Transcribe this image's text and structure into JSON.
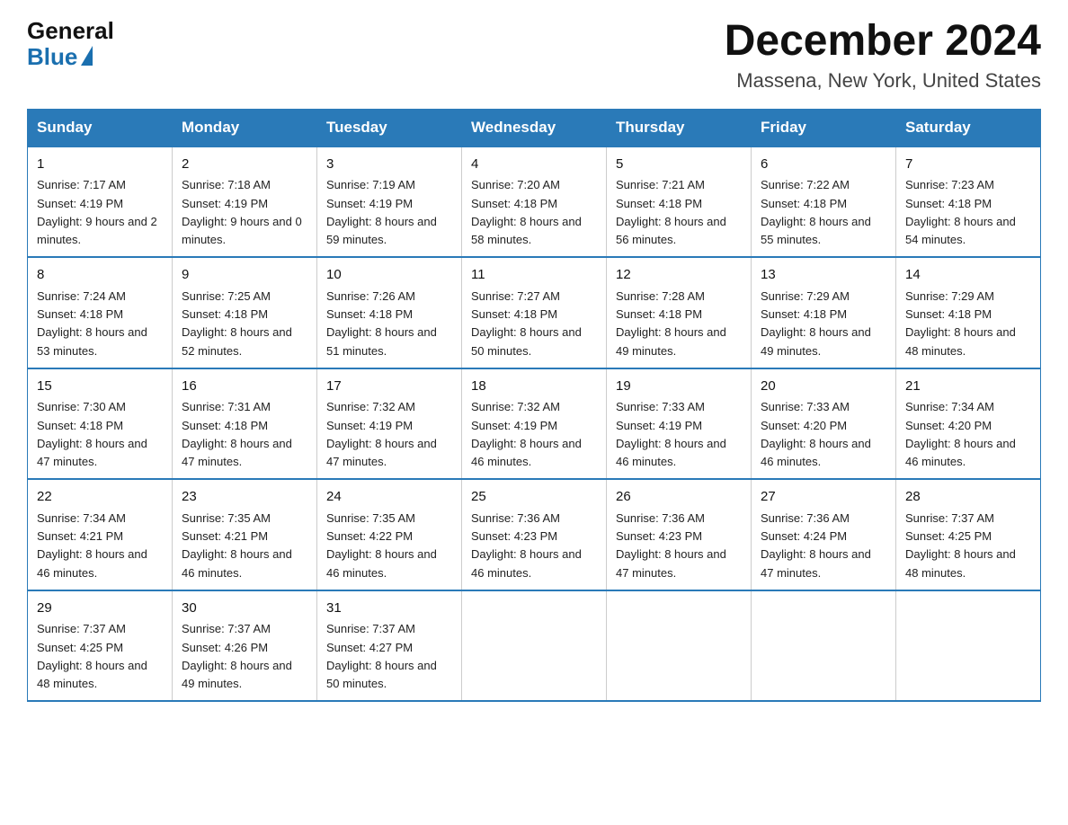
{
  "logo": {
    "general": "General",
    "blue": "Blue"
  },
  "title": "December 2024",
  "subtitle": "Massena, New York, United States",
  "days_of_week": [
    "Sunday",
    "Monday",
    "Tuesday",
    "Wednesday",
    "Thursday",
    "Friday",
    "Saturday"
  ],
  "weeks": [
    [
      {
        "day": "1",
        "sunrise": "Sunrise: 7:17 AM",
        "sunset": "Sunset: 4:19 PM",
        "daylight": "Daylight: 9 hours and 2 minutes."
      },
      {
        "day": "2",
        "sunrise": "Sunrise: 7:18 AM",
        "sunset": "Sunset: 4:19 PM",
        "daylight": "Daylight: 9 hours and 0 minutes."
      },
      {
        "day": "3",
        "sunrise": "Sunrise: 7:19 AM",
        "sunset": "Sunset: 4:19 PM",
        "daylight": "Daylight: 8 hours and 59 minutes."
      },
      {
        "day": "4",
        "sunrise": "Sunrise: 7:20 AM",
        "sunset": "Sunset: 4:18 PM",
        "daylight": "Daylight: 8 hours and 58 minutes."
      },
      {
        "day": "5",
        "sunrise": "Sunrise: 7:21 AM",
        "sunset": "Sunset: 4:18 PM",
        "daylight": "Daylight: 8 hours and 56 minutes."
      },
      {
        "day": "6",
        "sunrise": "Sunrise: 7:22 AM",
        "sunset": "Sunset: 4:18 PM",
        "daylight": "Daylight: 8 hours and 55 minutes."
      },
      {
        "day": "7",
        "sunrise": "Sunrise: 7:23 AM",
        "sunset": "Sunset: 4:18 PM",
        "daylight": "Daylight: 8 hours and 54 minutes."
      }
    ],
    [
      {
        "day": "8",
        "sunrise": "Sunrise: 7:24 AM",
        "sunset": "Sunset: 4:18 PM",
        "daylight": "Daylight: 8 hours and 53 minutes."
      },
      {
        "day": "9",
        "sunrise": "Sunrise: 7:25 AM",
        "sunset": "Sunset: 4:18 PM",
        "daylight": "Daylight: 8 hours and 52 minutes."
      },
      {
        "day": "10",
        "sunrise": "Sunrise: 7:26 AM",
        "sunset": "Sunset: 4:18 PM",
        "daylight": "Daylight: 8 hours and 51 minutes."
      },
      {
        "day": "11",
        "sunrise": "Sunrise: 7:27 AM",
        "sunset": "Sunset: 4:18 PM",
        "daylight": "Daylight: 8 hours and 50 minutes."
      },
      {
        "day": "12",
        "sunrise": "Sunrise: 7:28 AM",
        "sunset": "Sunset: 4:18 PM",
        "daylight": "Daylight: 8 hours and 49 minutes."
      },
      {
        "day": "13",
        "sunrise": "Sunrise: 7:29 AM",
        "sunset": "Sunset: 4:18 PM",
        "daylight": "Daylight: 8 hours and 49 minutes."
      },
      {
        "day": "14",
        "sunrise": "Sunrise: 7:29 AM",
        "sunset": "Sunset: 4:18 PM",
        "daylight": "Daylight: 8 hours and 48 minutes."
      }
    ],
    [
      {
        "day": "15",
        "sunrise": "Sunrise: 7:30 AM",
        "sunset": "Sunset: 4:18 PM",
        "daylight": "Daylight: 8 hours and 47 minutes."
      },
      {
        "day": "16",
        "sunrise": "Sunrise: 7:31 AM",
        "sunset": "Sunset: 4:18 PM",
        "daylight": "Daylight: 8 hours and 47 minutes."
      },
      {
        "day": "17",
        "sunrise": "Sunrise: 7:32 AM",
        "sunset": "Sunset: 4:19 PM",
        "daylight": "Daylight: 8 hours and 47 minutes."
      },
      {
        "day": "18",
        "sunrise": "Sunrise: 7:32 AM",
        "sunset": "Sunset: 4:19 PM",
        "daylight": "Daylight: 8 hours and 46 minutes."
      },
      {
        "day": "19",
        "sunrise": "Sunrise: 7:33 AM",
        "sunset": "Sunset: 4:19 PM",
        "daylight": "Daylight: 8 hours and 46 minutes."
      },
      {
        "day": "20",
        "sunrise": "Sunrise: 7:33 AM",
        "sunset": "Sunset: 4:20 PM",
        "daylight": "Daylight: 8 hours and 46 minutes."
      },
      {
        "day": "21",
        "sunrise": "Sunrise: 7:34 AM",
        "sunset": "Sunset: 4:20 PM",
        "daylight": "Daylight: 8 hours and 46 minutes."
      }
    ],
    [
      {
        "day": "22",
        "sunrise": "Sunrise: 7:34 AM",
        "sunset": "Sunset: 4:21 PM",
        "daylight": "Daylight: 8 hours and 46 minutes."
      },
      {
        "day": "23",
        "sunrise": "Sunrise: 7:35 AM",
        "sunset": "Sunset: 4:21 PM",
        "daylight": "Daylight: 8 hours and 46 minutes."
      },
      {
        "day": "24",
        "sunrise": "Sunrise: 7:35 AM",
        "sunset": "Sunset: 4:22 PM",
        "daylight": "Daylight: 8 hours and 46 minutes."
      },
      {
        "day": "25",
        "sunrise": "Sunrise: 7:36 AM",
        "sunset": "Sunset: 4:23 PM",
        "daylight": "Daylight: 8 hours and 46 minutes."
      },
      {
        "day": "26",
        "sunrise": "Sunrise: 7:36 AM",
        "sunset": "Sunset: 4:23 PM",
        "daylight": "Daylight: 8 hours and 47 minutes."
      },
      {
        "day": "27",
        "sunrise": "Sunrise: 7:36 AM",
        "sunset": "Sunset: 4:24 PM",
        "daylight": "Daylight: 8 hours and 47 minutes."
      },
      {
        "day": "28",
        "sunrise": "Sunrise: 7:37 AM",
        "sunset": "Sunset: 4:25 PM",
        "daylight": "Daylight: 8 hours and 48 minutes."
      }
    ],
    [
      {
        "day": "29",
        "sunrise": "Sunrise: 7:37 AM",
        "sunset": "Sunset: 4:25 PM",
        "daylight": "Daylight: 8 hours and 48 minutes."
      },
      {
        "day": "30",
        "sunrise": "Sunrise: 7:37 AM",
        "sunset": "Sunset: 4:26 PM",
        "daylight": "Daylight: 8 hours and 49 minutes."
      },
      {
        "day": "31",
        "sunrise": "Sunrise: 7:37 AM",
        "sunset": "Sunset: 4:27 PM",
        "daylight": "Daylight: 8 hours and 50 minutes."
      },
      null,
      null,
      null,
      null
    ]
  ]
}
